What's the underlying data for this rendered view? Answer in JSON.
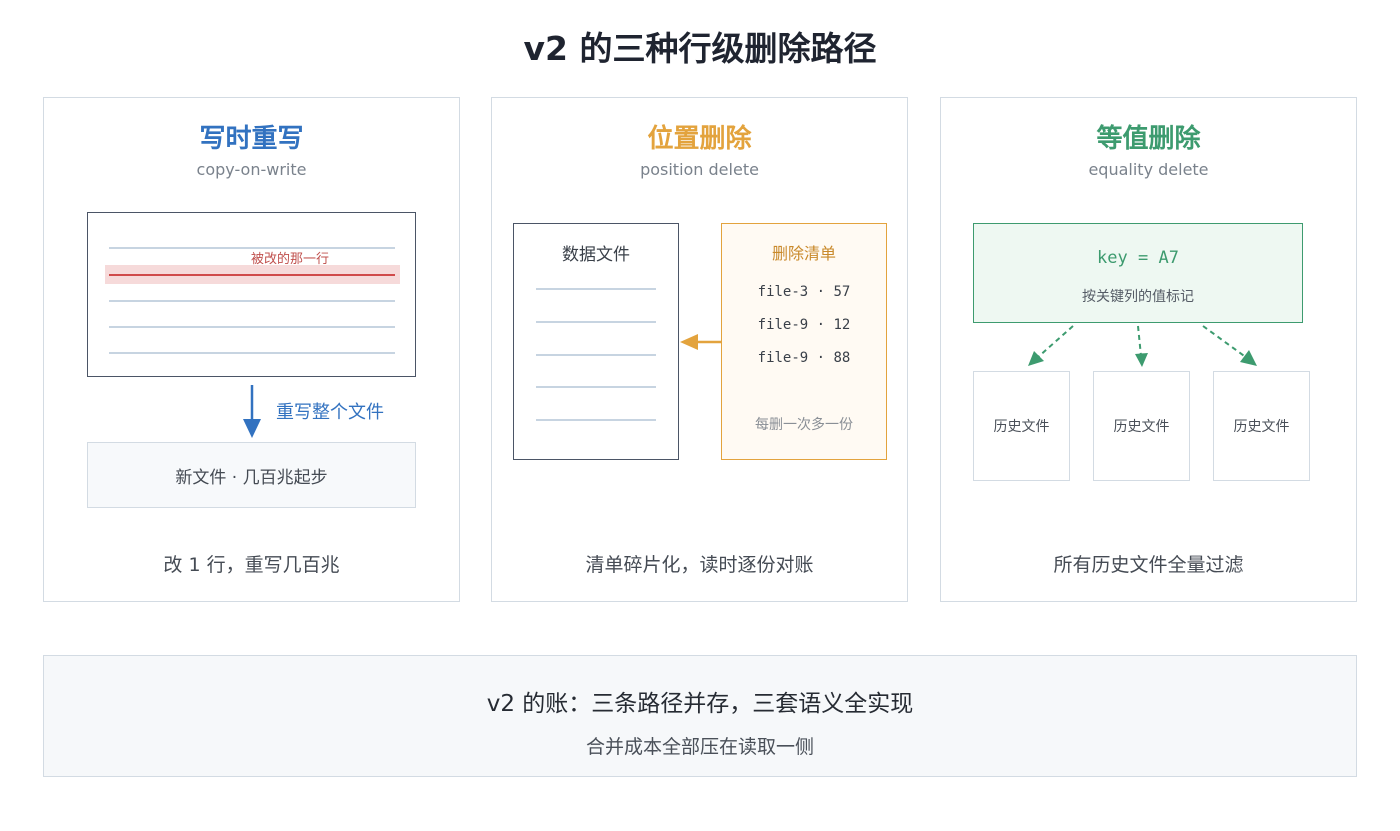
{
  "title": "v2 的三种行级删除路径",
  "colors": {
    "blue": "#3272c0",
    "orange": "#e3a33d",
    "green": "#3d9b6f",
    "highlight_red": "#d04a4a"
  },
  "cards": [
    {
      "title": "写时重写",
      "subtitle": "copy-on-write",
      "highlight_label": "被改的那一行",
      "arrow_label": "重写整个文件",
      "new_file": "新文件 · 几百兆起步",
      "caption": "改 1 行，重写几百兆"
    },
    {
      "title": "位置删除",
      "subtitle": "position delete",
      "data_file_label": "数据文件",
      "delete_list_title": "删除清单",
      "delete_entries": [
        "file-3 · 57",
        "file-9 · 12",
        "file-9 · 88"
      ],
      "delete_list_note": "每删一次多一份",
      "caption": "清单碎片化，读时逐份对账"
    },
    {
      "title": "等值删除",
      "subtitle": "equality delete",
      "key_text": "key = A7",
      "key_note": "按关键列的值标记",
      "history_files": [
        "历史文件",
        "历史文件",
        "历史文件"
      ],
      "caption": "所有历史文件全量过滤"
    }
  ],
  "summary": {
    "main": "v2 的账：三条路径并存，三套语义全实现",
    "sub": "合并成本全部压在读取一侧"
  }
}
